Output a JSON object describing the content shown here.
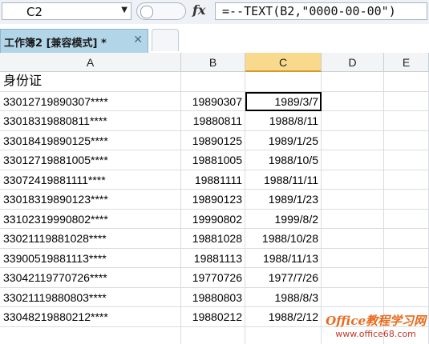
{
  "formula_bar": {
    "name_box": "C2",
    "formula": "=--TEXT(B2,\"0000-00-00\")",
    "fx_label": "fx"
  },
  "tabs": [
    {
      "label": "工作簿2  [兼容模式] *",
      "close": "✕"
    }
  ],
  "columns": [
    "A",
    "B",
    "C",
    "D",
    "E"
  ],
  "selected_column": "C",
  "active_cell": "C2",
  "rows": [
    {
      "a": "身份证",
      "b": "",
      "c": ""
    },
    {
      "a": "33012719890307****",
      "b": "19890307",
      "c": "1989/3/7"
    },
    {
      "a": "33018319880811****",
      "b": "19880811",
      "c": "1988/8/11"
    },
    {
      "a": "33018419890125****",
      "b": "19890125",
      "c": "1989/1/25"
    },
    {
      "a": "33012719881005****",
      "b": "19881005",
      "c": "1988/10/5"
    },
    {
      "a": "33072419881111****",
      "b": "19881111",
      "c": "1988/11/11"
    },
    {
      "a": "33018319890123****",
      "b": "19890123",
      "c": "1989/1/23"
    },
    {
      "a": "33102319990802****",
      "b": "19990802",
      "c": "1999/8/2"
    },
    {
      "a": "33021119881028****",
      "b": "19881028",
      "c": "1988/10/28"
    },
    {
      "a": "33900519881113****",
      "b": "19881113",
      "c": "1988/11/13"
    },
    {
      "a": "33042119770726****",
      "b": "19770726",
      "c": "1977/7/26"
    },
    {
      "a": "33021119880803****",
      "b": "19880803",
      "c": "1988/8/3"
    },
    {
      "a": "33048219880212****",
      "b": "19880212",
      "c": "1988/2/12"
    },
    {
      "a": "",
      "b": "",
      "c": ""
    }
  ],
  "watermark": {
    "line1": "Office教程学习网",
    "line2": "www.office68.com"
  },
  "colors": {
    "tab_active": "#b2d5e8",
    "selected_header": "#f8d98d",
    "watermark": "#e86a1c"
  }
}
